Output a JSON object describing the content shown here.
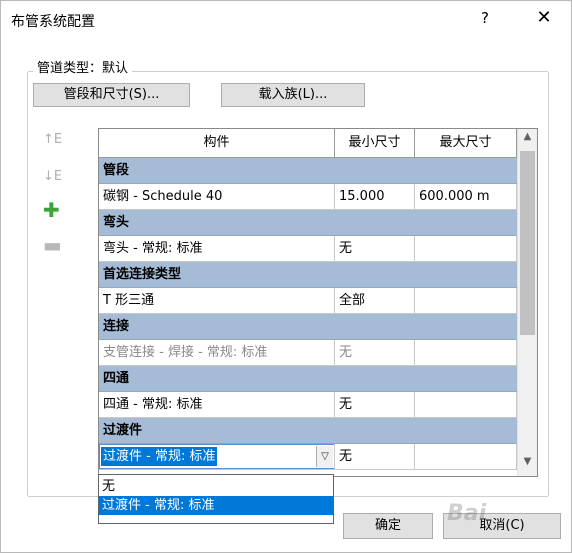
{
  "window": {
    "title": "布管系统配置",
    "help": "?",
    "close": "✕"
  },
  "pipe_type": {
    "label": "管道类型：",
    "value": "默认"
  },
  "buttons": {
    "segments": "管段和尺寸(S)...",
    "load_family": "载入族(L)...",
    "ok": "确定",
    "cancel": "取消(C)"
  },
  "side_tools": {
    "move_up": "↑E",
    "move_down": "↓E",
    "add": "✚",
    "remove": "▬"
  },
  "grid": {
    "headers": [
      "构件",
      "最小尺寸",
      "最大尺寸"
    ],
    "sections": [
      {
        "category": "管段",
        "rows": [
          {
            "name": "碳钢 - Schedule 40",
            "min": "15.000",
            "max": "600.000 m"
          }
        ]
      },
      {
        "category": "弯头",
        "rows": [
          {
            "name": "弯头 - 常规: 标准",
            "min": "无",
            "max": ""
          }
        ]
      },
      {
        "category": "首选连接类型",
        "rows": [
          {
            "name": "T 形三通",
            "min": "全部",
            "max": ""
          }
        ]
      },
      {
        "category": "连接",
        "rows": [
          {
            "name": "支管连接 - 焊接 - 常规: 标准",
            "min": "无",
            "max": "",
            "disabled": true
          }
        ]
      },
      {
        "category": "四通",
        "rows": [
          {
            "name": "四通 - 常规: 标准",
            "min": "无",
            "max": ""
          }
        ]
      },
      {
        "category": "过渡件",
        "rows": [
          {
            "name": "过渡件 - 常规: 标准",
            "min": "无",
            "max": "",
            "editing": true
          }
        ]
      }
    ]
  },
  "scrollbar": {
    "up": "▲",
    "down": "▼"
  },
  "combo_arrow": "▽",
  "dropdown": {
    "options": [
      "无",
      "过渡件 - 常规: 标准"
    ],
    "selected_index": 1
  },
  "watermark": "Bai"
}
